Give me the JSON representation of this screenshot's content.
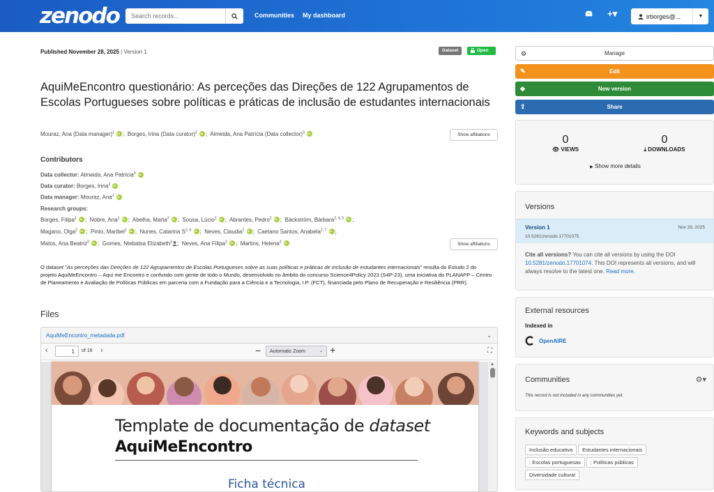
{
  "header": {
    "logo": "zenodo",
    "search_placeholder": "Search records...",
    "nav": [
      "Communities",
      "My dashboard"
    ],
    "user": "irborges@..."
  },
  "record": {
    "published": "Published November 28, 2025",
    "version": "| Version 1",
    "badge_type": "Dataset",
    "badge_access": "Open",
    "title": "AquiMeEncontro questionário: As perceções das Direções de 122 Agrupamentos de Escolas Portugueses sobre políticas e práticas de inclusão de estudantes internacionais",
    "creators": [
      {
        "name": "Mouraz, Ana (Data manager)",
        "sup": "1"
      },
      {
        "name": "Borges, Irina (Data curator)",
        "sup": "2"
      },
      {
        "name": "Almeida, Ana Patrícia (Data collector)",
        "sup": "3"
      }
    ],
    "show_affiliations": "Show affiliations",
    "contributors_heading": "Contributors",
    "data_collector_label": "Data collector:",
    "data_collector": "Almeida, Ana Patrícia",
    "data_collector_sup": "3",
    "data_curator_label": "Data curator:",
    "data_curator": "Borges, Irina",
    "data_curator_sup": "2",
    "data_manager_label": "Data manager:",
    "data_manager": "Mouraz, Ana",
    "data_manager_sup": "1",
    "research_groups_label": "Research groups:",
    "rg_row1": [
      {
        "n": "Borges, Filipa",
        "s": "2"
      },
      {
        "n": "Nobre, Ana",
        "s": "2"
      },
      {
        "n": "Abelha, Marta",
        "s": "2"
      },
      {
        "n": "Sousa, Lúcio",
        "s": "2"
      },
      {
        "n": "Abrantes, Pedro",
        "s": "2"
      },
      {
        "n": "Bäckström, Bárbara",
        "s": "2, 4, 5"
      }
    ],
    "rg_row2": [
      {
        "n": "Magano, Olga",
        "s": "2"
      },
      {
        "n": "Pinto, Maribel",
        "s": "1"
      },
      {
        "n": "Nunes, Catarina S",
        "s": "2, 6"
      },
      {
        "n": "Neves, Claudia",
        "s": "2"
      },
      {
        "n": "Caetano Santos, Anabela",
        "s": "2, 7"
      }
    ],
    "rg_row3": [
      {
        "n": "Matos, Ana Beatriz",
        "s": "2"
      },
      {
        "n": "Gomes, Ntebatsa Elizabeth",
        "s": "2"
      },
      {
        "n": "Neves, Ana Filipa",
        "s": "2"
      },
      {
        "n": "Martins, Helena",
        "s": "2"
      }
    ],
    "desc_pre": "O ",
    "desc_italic1": "dataset",
    "desc_quote": " \"",
    "desc_italic2": "As perceções das Direções de 122 Agrupamentos de Escolas Portugueses sobre as suas políticas e práticas de inclusão de estudantes internacionais",
    "desc_rest": "\" resulta do Estudo 2 do projeto AquiMeEncontro – Aqui me Encontro e confundo com gente de todo o Mundo, desenvolvido no âmbito do concurso Science4Policy 2023 (S4P-23), uma iniciativa do PLANAPP – Centro de Planeamento e Avaliação de Políticas Públicas em parceria com a Fundação para a Ciência e a Tecnologia, I.P. (FCT), financiada pelo Plano de Recuperação e Resiliência (PRR).",
    "files_heading": "Files"
  },
  "viewer": {
    "filename": "AquiMeEncontro_metadada.pdf",
    "page": "1",
    "of_pages": "of 16",
    "zoom": "Automatic Zoom",
    "doc_title_1": "Template de documentação de ",
    "doc_title_italic": "dataset",
    "doc_sub": "AquiMeEncontro",
    "doc_ficha": "Ficha técnica"
  },
  "sidebar": {
    "manage": "Manage",
    "edit": "Edit",
    "new_version": "New version",
    "share": "Share",
    "views_count": "0",
    "views_label": "VIEWS",
    "downloads_count": "0",
    "downloads_label": "DOWNLOADS",
    "more_details": "Show more details",
    "versions_heading": "Versions",
    "version_name": "Version 1",
    "version_date": "Nov 28, 2025",
    "version_doi": "10.5281/zenodo.17701075",
    "cite_bold": "Cite all versions?",
    "cite_text": " You can cite all versions by using the DOI ",
    "cite_doi": "10.5281/zenodo.17701074",
    "cite_text2": ". This DOI represents all versions, and will always resolve to the latest one. ",
    "read_more": "Read more.",
    "external_heading": "External resources",
    "indexed_in": "Indexed in",
    "openaire": "OpenAIRE",
    "communities_heading": "Communities",
    "communities_empty": "This record is not included in any communities yet.",
    "keywords_heading": "Keywords and subjects",
    "keywords": [
      "Inclusão educativa",
      "Estudantes internacionais",
      "; Escolas portuguesas",
      "; Políticas públicas",
      "Diversidade cultural"
    ]
  },
  "colors": {
    "header_blue": "#1f72d6",
    "edit_orange": "#f2711c",
    "new_version_green": "#21ba45",
    "share_blue": "#2185d0",
    "open_green": "#21ba45",
    "link_blue": "#1a6ec2"
  }
}
